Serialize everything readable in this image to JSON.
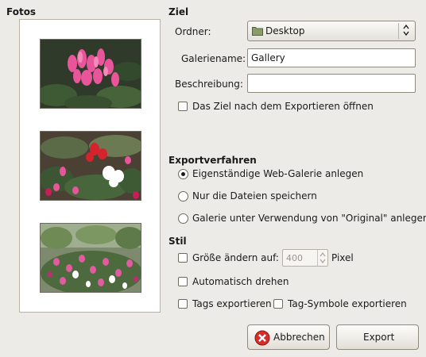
{
  "photos_section": {
    "title": "Fotos"
  },
  "destination": {
    "title": "Ziel",
    "folder_label": "Ordner:",
    "folder_value": "Desktop",
    "gallery_name_label": "Galeriename:",
    "gallery_name_value": "Gallery",
    "description_label": "Beschreibung:",
    "description_value": "",
    "open_after_export_label": "Das Ziel nach dem Exportieren öffnen",
    "open_after_export_checked": false
  },
  "export_method": {
    "title": "Exportverfahren",
    "options": [
      {
        "label": "Eigenständige Web-Galerie anlegen",
        "selected": true
      },
      {
        "label": "Nur die Dateien speichern",
        "selected": false
      },
      {
        "label": "Galerie unter Verwendung von \"Original\" anlegen",
        "selected": false
      }
    ]
  },
  "style": {
    "title": "Stil",
    "resize_label": "Größe ändern auf:",
    "resize_checked": false,
    "resize_value": "400",
    "resize_unit": "Pixel",
    "auto_rotate_label": "Automatisch drehen",
    "auto_rotate_checked": false,
    "export_tags_label": "Tags exportieren",
    "export_tags_checked": false,
    "export_tag_icons_label": "Tag-Symbole exportieren",
    "export_tag_icons_checked": false
  },
  "buttons": {
    "cancel_label": "Abbrechen",
    "export_label": "Export"
  },
  "icons": {
    "cancel": "cancel-icon",
    "folder": "folder-icon",
    "combo_arrows": "updown-arrows-icon"
  },
  "colors": {
    "window_bg": "#edebe7",
    "cancel_icon": "#d2302c"
  }
}
